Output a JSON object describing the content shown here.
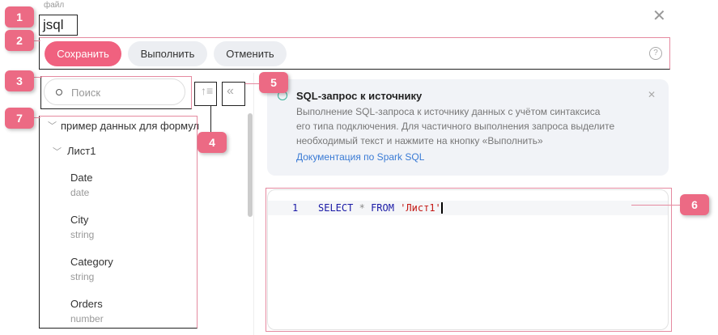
{
  "header": {
    "file_label": "файл",
    "file_name": "jsql"
  },
  "toolbar": {
    "save": "Сохранить",
    "run": "Выполнить",
    "cancel": "Отменить"
  },
  "search": {
    "placeholder": "Поиск"
  },
  "tree": {
    "source": "пример данных для формул",
    "sheet": "Лист1",
    "fields": [
      {
        "name": "Date",
        "type": "date"
      },
      {
        "name": "City",
        "type": "string"
      },
      {
        "name": "Category",
        "type": "string"
      },
      {
        "name": "Orders",
        "type": "number"
      }
    ]
  },
  "info": {
    "title": "SQL-запрос к источнику",
    "lines": [
      "Выполнение SQL-запроса к источнику данных с учётом синтаксиса",
      "его типа подключения. Для частичного выполнения запроса выделите",
      "необходимый текст и нажмите на кнопку «Выполнить»"
    ],
    "link": "Документация по Spark SQL"
  },
  "editor": {
    "line_number": "1",
    "kw1": "SELECT",
    "star": "*",
    "kw2": "FROM",
    "str": "'Лист1'"
  },
  "badges": [
    "1",
    "2",
    "3",
    "4",
    "5",
    "6",
    "7"
  ],
  "colors": {
    "accent": "#f0617f",
    "link": "#3a7bd5",
    "keyword": "#1a1aa6",
    "string": "#c41a16"
  }
}
